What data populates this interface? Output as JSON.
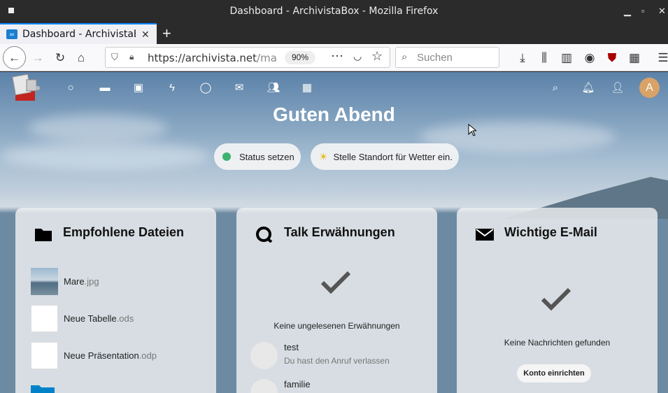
{
  "window": {
    "title": "Dashboard - ArchivistaBox - Mozilla Firefox"
  },
  "tab": {
    "label": "Dashboard - ArchivistaBox",
    "close": "✕"
  },
  "newtab": "+",
  "nav": {
    "url_host": "https://archivista.net",
    "url_path": "/mars/",
    "zoom": "90%",
    "search_placeholder": "Suchen"
  },
  "greeting": "Guten Abend",
  "status": {
    "label": "Status setzen"
  },
  "weather": {
    "label": "Stelle Standort für Wetter ein."
  },
  "avatar_letter": "A",
  "widgets": {
    "files": {
      "title": "Empfohlene Dateien",
      "items": [
        {
          "name": "Mare",
          "ext": ".jpg"
        },
        {
          "name": "Neue Tabelle",
          "ext": ".ods"
        },
        {
          "name": "Neue Präsentation",
          "ext": ".odp"
        }
      ]
    },
    "talk": {
      "title": "Talk Erwähnungen",
      "empty": "Keine ungelesenen Erwähnungen",
      "items": [
        {
          "name": "test",
          "message": "Du hast den Anruf verlassen"
        },
        {
          "name": "familie",
          "message": ""
        }
      ]
    },
    "mail": {
      "title": "Wichtige E-Mail",
      "empty": "Keine Nachrichten gefunden",
      "button": "Konto einrichten"
    }
  },
  "colors": {
    "accent": "#0a84ff",
    "avatar": "#d9a266",
    "status_green": "#3cb371"
  }
}
